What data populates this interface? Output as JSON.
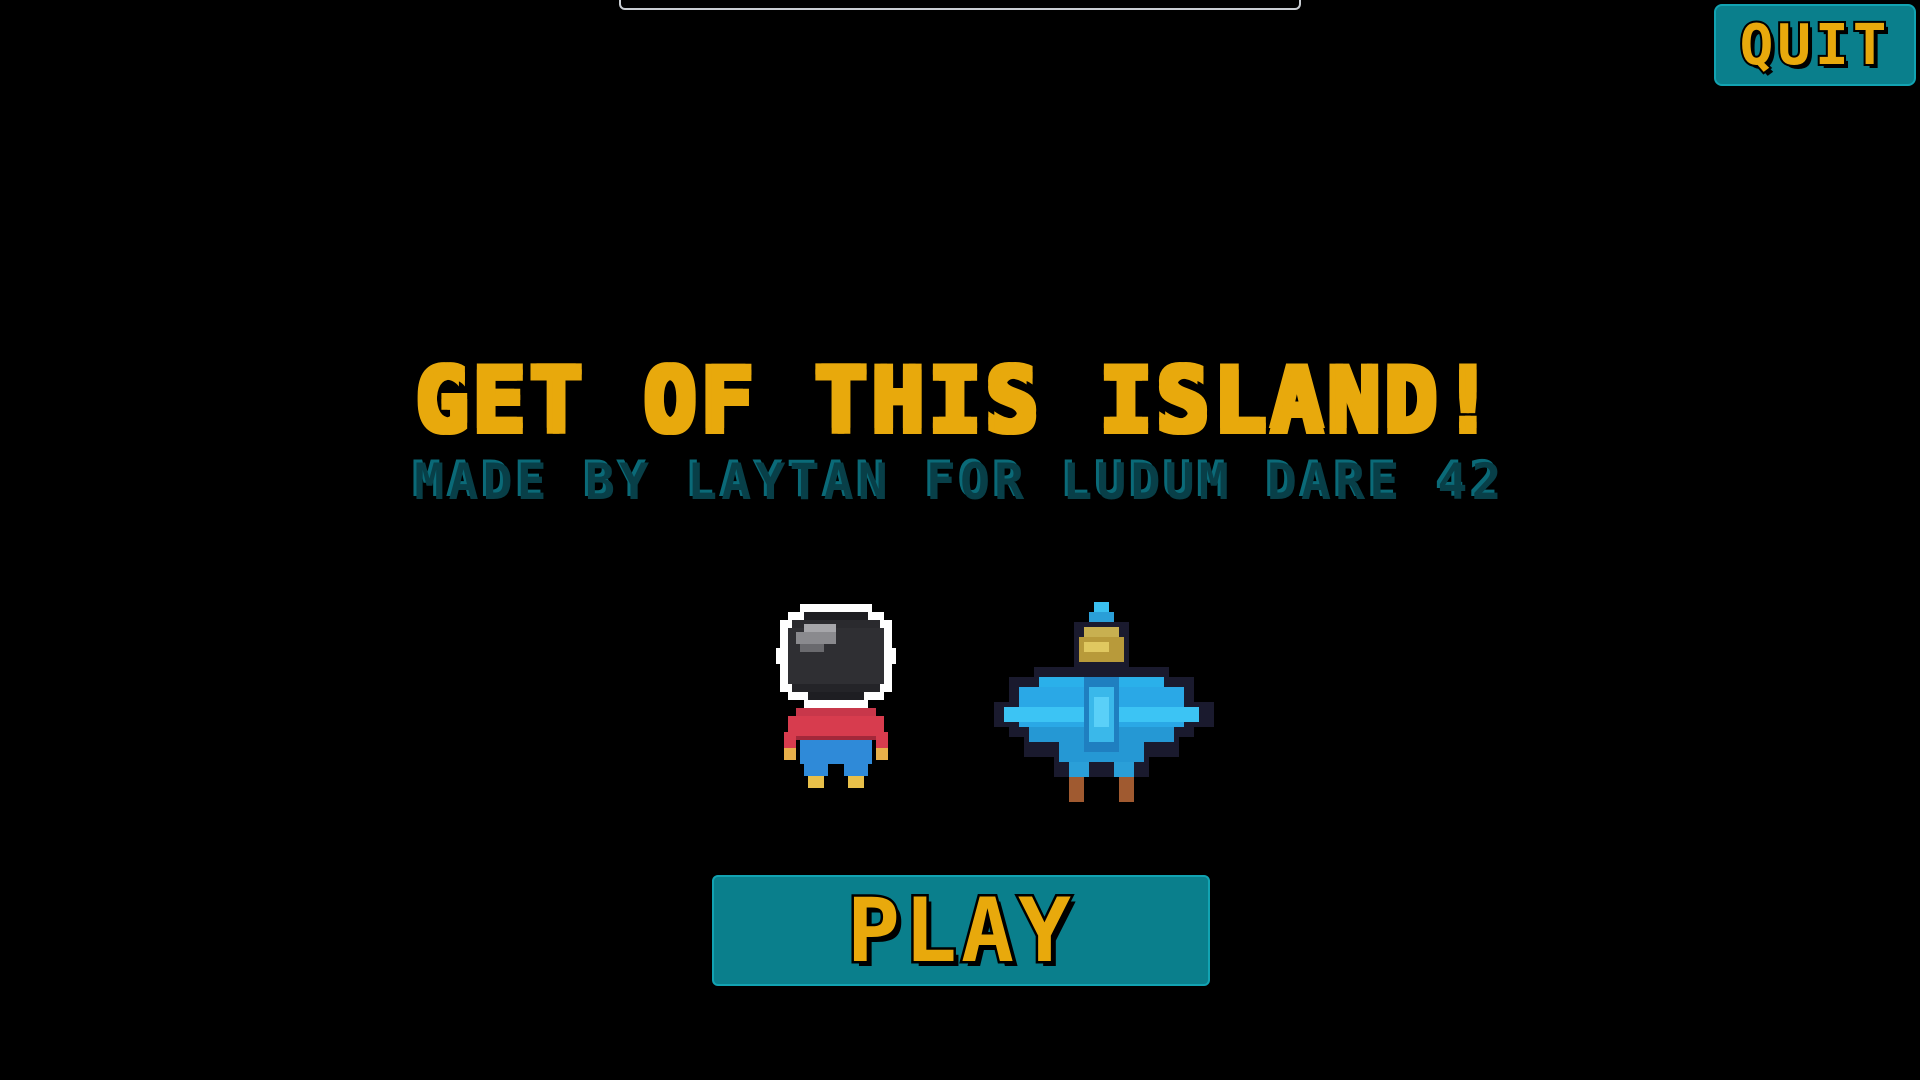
{
  "menu": {
    "title": "GET OF THIS ISLAND!",
    "subtitle": "MADE BY LAYTAN FOR LUDUM DARE 42",
    "play_label": "PLAY",
    "quit_label": "QUIT"
  },
  "colors": {
    "background": "#000000",
    "accent_gold": "#e8a90c",
    "button_teal": "#0a7f8c",
    "subtitle_teal": "#083f48"
  },
  "sprites": {
    "player": "astronaut-player-sprite",
    "enemy": "blue-bird-sprite"
  }
}
